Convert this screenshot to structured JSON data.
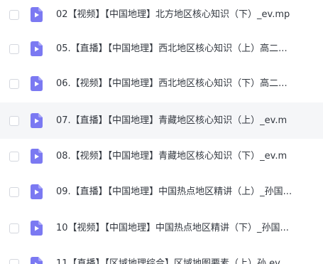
{
  "colors": {
    "file_icon": "#7b79f2",
    "row_hover_bg": "#f5f6f8",
    "text": "#32373f"
  },
  "file_list": {
    "items": [
      {
        "name": "02【视频】【中国地理】北方地区核心知识（下）_ev.mp",
        "icon": "video-file-icon",
        "checked": false
      },
      {
        "name": "05.【直播】【中国地理】西北地区核心知识（上）高二...",
        "icon": "video-file-icon",
        "checked": false
      },
      {
        "name": "06.【视频】【中国地理】西北地区核心知识（下）高二...",
        "icon": "video-file-icon",
        "checked": false
      },
      {
        "name": "07.【直播】【中国地理】青藏地区核心知识（上）_ev.m",
        "icon": "video-file-icon",
        "checked": false,
        "hovered": true
      },
      {
        "name": "08.【视频】【中国地理】青藏地区核心知识（下）_ev.m",
        "icon": "video-file-icon",
        "checked": false
      },
      {
        "name": "09.【直播】【中国地理】中国热点地区精讲（上）_孙国...",
        "icon": "video-file-icon",
        "checked": false
      },
      {
        "name": "10【视频】【中国地理】中国热点地区精讲（下）_孙国...",
        "icon": "video-file-icon",
        "checked": false
      },
      {
        "name": "11【直播】【区域地理综合】区域地图要素（上）孙 ev",
        "icon": "video-file-icon",
        "checked": false
      }
    ]
  }
}
